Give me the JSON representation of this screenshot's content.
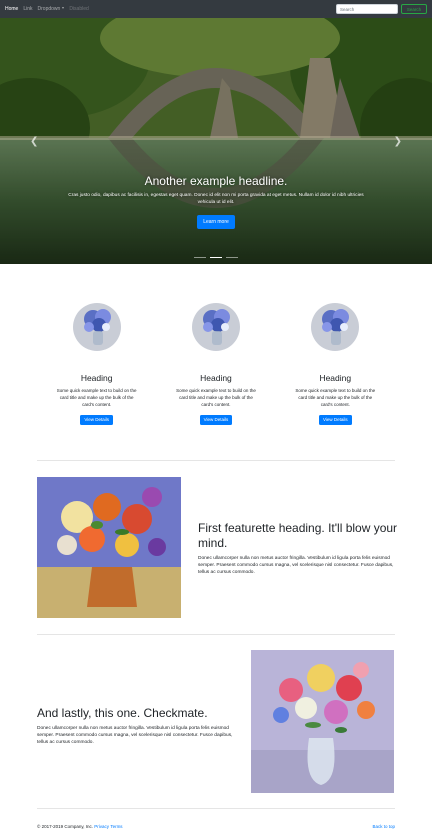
{
  "nav": {
    "home": "Home",
    "link": "Link",
    "dropdown": "Dropdown",
    "disabled": "Disabled",
    "search_placeholder": "Search",
    "search_button": "Search"
  },
  "carousel": {
    "headline": "Another example headline.",
    "text": "Cras justo odio, dapibus ac facilisis in, egestas eget quam. Donec id elit non mi porta gravida at eget metus. Nullam id dolor id nibh ultricies vehicula ut id elit.",
    "button": "Learn more",
    "prev_icon": "chevron-left-icon",
    "next_icon": "chevron-right-icon",
    "slides": 3,
    "active_slide": 2
  },
  "marketing": [
    {
      "heading": "Heading",
      "text": "Some quick example text to build on the card title and make up the bulk of the card's content.",
      "button": "View Details"
    },
    {
      "heading": "Heading",
      "text": "Some quick example text to build on the card title and make up the bulk of the card's content.",
      "button": "View Details"
    },
    {
      "heading": "Heading",
      "text": "Some quick example text to build on the card title and make up the bulk of the card's content.",
      "button": "View Details"
    }
  ],
  "featurette1": {
    "heading": "First featurette heading. It'll blow your mind.",
    "text": "Donec ullamcorper nulla non metus auctor fringilla. Vestibulum id ligula porta felis euismod semper. Praesent commodo cursus magna, vel scelerisque nisl consectetur. Fusce dapibus, tellus ac cursus commodo."
  },
  "featurette2": {
    "heading": "And lastly, this one. Checkmate.",
    "text": "Donec ullamcorper nulla non metus auctor fringilla. Vestibulum id ligula porta felis euismod semper. Praesent commodo cursus magna, vel scelerisque nisl consectetur. Fusce dapibus, tellus ac cursus commodo."
  },
  "footer": {
    "copyright": "© 2017-2019 Company, Inc.",
    "privacy": "Privacy",
    "terms": "Terms",
    "back_to_top": "Back to top"
  },
  "colors": {
    "navbar": "#343a40",
    "primary": "#007bff",
    "success": "#28a745"
  }
}
